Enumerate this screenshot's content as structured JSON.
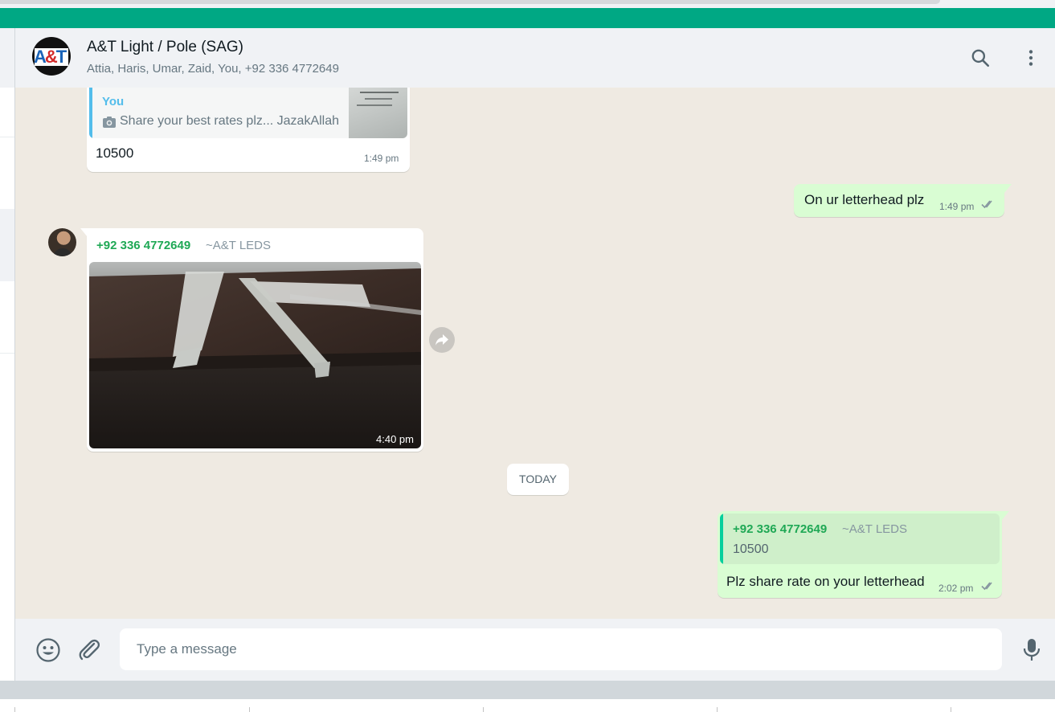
{
  "header": {
    "title": "A&T Light / Pole (SAG)",
    "members": "Attia, Haris, Umar, Zaid, You, +92 336 4772649",
    "logo_text_a": "A",
    "logo_text_amp": "&",
    "logo_text_t": "T"
  },
  "messages": {
    "m1": {
      "quote_author": "You",
      "quote_text": "Share your best rates plz... JazakAllah",
      "text": "10500",
      "time": "1:49 pm"
    },
    "m2": {
      "text": "On ur letterhead plz",
      "time": "1:49 pm"
    },
    "m3": {
      "sender_number": "+92 336 4772649",
      "sender_name": "~A&T LEDS",
      "time": "4:40 pm"
    },
    "date_divider": "TODAY",
    "m4": {
      "quote_author": "+92 336 4772649",
      "quote_name": "~A&T LEDS",
      "quote_text": "10500",
      "text": "Plz share rate on your letterhead",
      "time": "2:02 pm"
    }
  },
  "composer": {
    "placeholder": "Type a message"
  },
  "colors": {
    "brand_green": "#00a884",
    "outgoing_bubble": "#d9fdd3",
    "incoming_bubble": "#ffffff",
    "chat_background": "#efeae2",
    "read_tick": "#8696a0",
    "sender_color": "#1fa855",
    "self_quote_color": "#53bdeb"
  },
  "icons": {
    "header": [
      "search-icon",
      "menu-dots-icon"
    ],
    "composer": [
      "emoji-icon",
      "attach-icon",
      "mic-icon"
    ],
    "message": [
      "camera-icon",
      "double-check-icon",
      "forward-icon"
    ]
  }
}
